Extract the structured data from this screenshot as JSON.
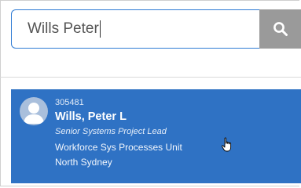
{
  "search": {
    "value": "Wills Peter",
    "button_icon": "search-icon",
    "input_border_color": "#2f7bd4",
    "button_color": "#9a9a9a"
  },
  "result": {
    "employee_id": "305481",
    "name": "Wills, Peter L",
    "job_title": "Senior Systems Project Lead",
    "unit": "Workforce Sys Processes Unit",
    "location": "North Sydney",
    "avatar_icon": "person-icon",
    "highlight_color": "#2f72c4"
  }
}
